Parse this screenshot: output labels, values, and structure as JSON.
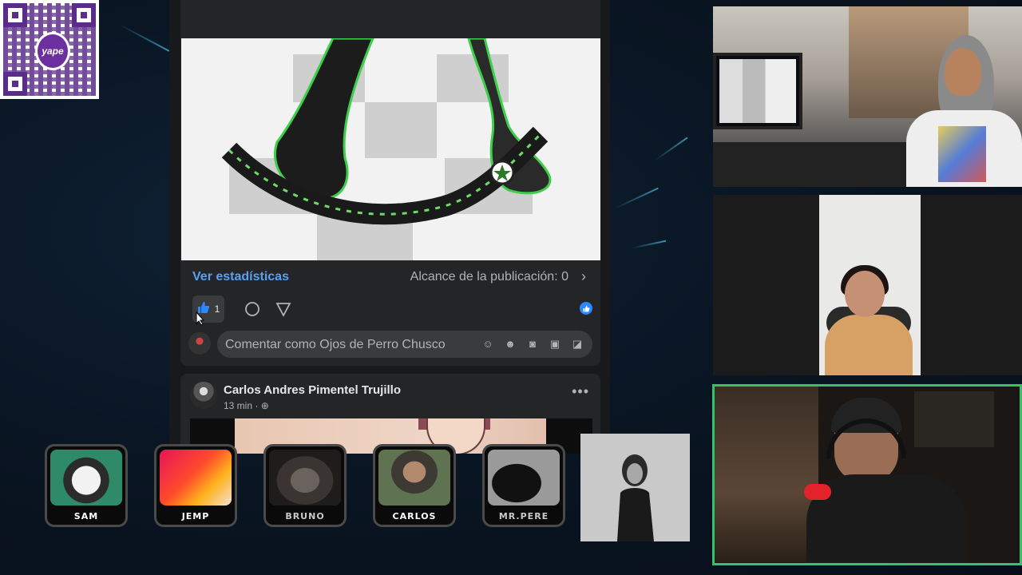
{
  "qr": {
    "logo_text": "yape"
  },
  "facebook_post": {
    "stats_link": "Ver estadísticas",
    "reach_text": "Alcance de la publicación: 0",
    "like_count": "1",
    "comment_placeholder": "Comentar como Ojos de Perro Chusco"
  },
  "next_post": {
    "author": "Carlos Andres Pimentel Trujillo",
    "time": "13 min ·",
    "more": "•••"
  },
  "avatars": [
    {
      "label": "SAM"
    },
    {
      "label": "JEMP"
    },
    {
      "label": "BRUNO"
    },
    {
      "label": "CARLOS"
    },
    {
      "label": "MR.PERE"
    }
  ],
  "colors": {
    "accent_link": "#5aa0f2",
    "like_blue": "#2d88ff",
    "active_cam_border": "#35c26a"
  }
}
